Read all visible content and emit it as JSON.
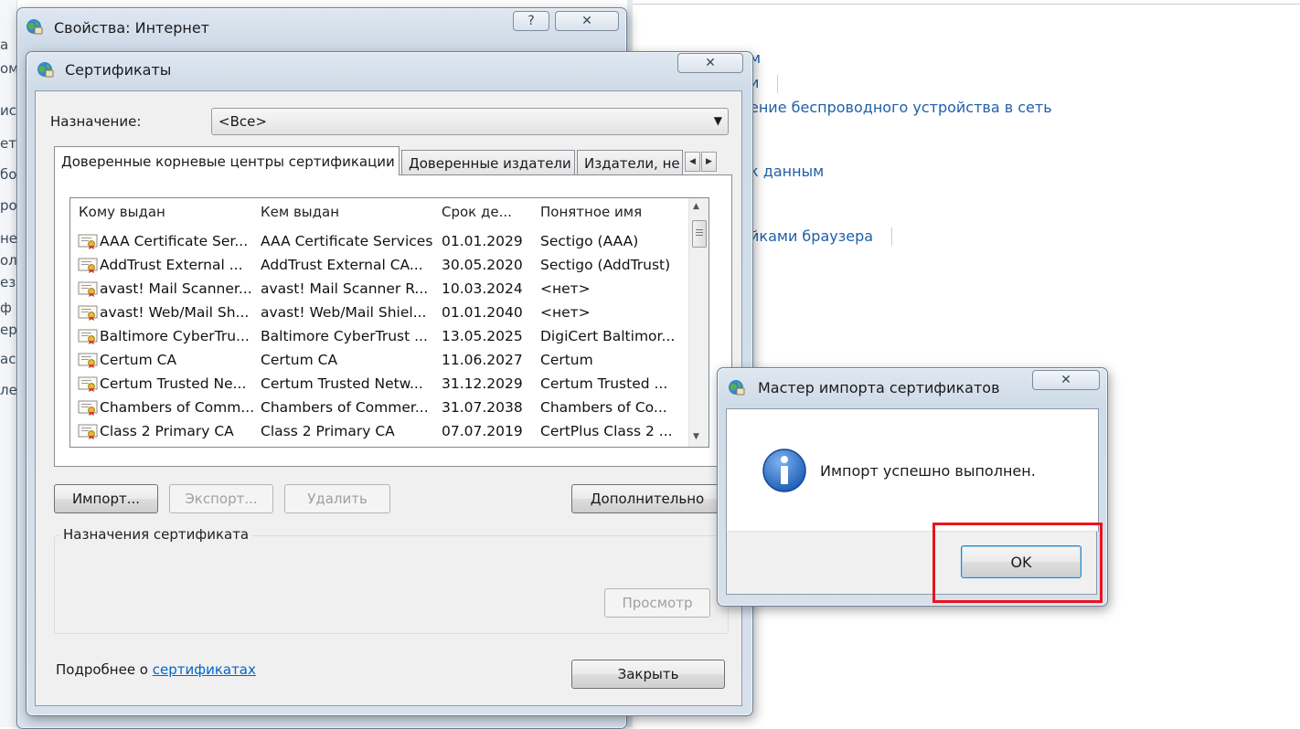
{
  "background": {
    "left_fragments": [
      "а",
      "ом",
      "ис",
      "ети",
      "бо",
      "ро",
      "не",
      "ол",
      "ез",
      "ф",
      "ер",
      "ас",
      "ле"
    ],
    "links": [
      "м",
      "и",
      "ение беспроводного устройства в сеть",
      "к данным",
      "йками браузера"
    ]
  },
  "internet_options": {
    "title": "Свойства: Интернет",
    "help_btn": "?",
    "close_btn": "✕"
  },
  "certificates": {
    "title": "Сертификаты",
    "close_btn": "✕",
    "purpose_label": "Назначение:",
    "purpose_value": "<Все>",
    "tabs": [
      {
        "label": "Доверенные корневые центры сертификации",
        "active": true
      },
      {
        "label": "Доверенные издатели",
        "active": false
      },
      {
        "label": "Издатели, не",
        "active": false
      }
    ],
    "columns": [
      "Кому выдан",
      "Кем выдан",
      "Срок де...",
      "Понятное имя"
    ],
    "rows": [
      {
        "to": "AAA Certificate Ser...",
        "by": "AAA Certificate Services",
        "exp": "01.01.2029",
        "name": "Sectigo (AAA)"
      },
      {
        "to": "AddTrust External ...",
        "by": "AddTrust External CA...",
        "exp": "30.05.2020",
        "name": "Sectigo (AddTrust)"
      },
      {
        "to": "avast! Mail Scanner...",
        "by": "avast! Mail Scanner R...",
        "exp": "10.03.2024",
        "name": "<нет>"
      },
      {
        "to": "avast! Web/Mail Sh...",
        "by": "avast! Web/Mail Shiel...",
        "exp": "01.01.2040",
        "name": "<нет>"
      },
      {
        "to": "Baltimore CyberTru...",
        "by": "Baltimore CyberTrust ...",
        "exp": "13.05.2025",
        "name": "DigiCert Baltimor..."
      },
      {
        "to": "Certum CA",
        "by": "Certum CA",
        "exp": "11.06.2027",
        "name": "Certum"
      },
      {
        "to": "Certum Trusted Ne...",
        "by": "Certum Trusted Netw...",
        "exp": "31.12.2029",
        "name": "Certum Trusted ..."
      },
      {
        "to": "Chambers of Comm...",
        "by": "Chambers of Commer...",
        "exp": "31.07.2038",
        "name": "Chambers of Co..."
      },
      {
        "to": "Class 2 Primary CA",
        "by": "Class 2 Primary CA",
        "exp": "07.07.2019",
        "name": "CertPlus Class 2 ..."
      }
    ],
    "buttons": {
      "import": "Импорт...",
      "export": "Экспорт...",
      "remove": "Удалить",
      "advanced": "Дополнительно",
      "view": "Просмотр",
      "close": "Закрыть"
    },
    "purposes_group": "Назначения сертификата",
    "more_info_prefix": "Подробнее о ",
    "more_info_link": "сертификатах"
  },
  "import_wizard": {
    "title": "Мастер импорта сертификатов",
    "close_btn": "✕",
    "message": "Импорт успешно выполнен.",
    "ok": "OK"
  },
  "colors": {
    "highlight": "#e8141e",
    "link": "#0066cc",
    "info_icon": "#1f5fb8"
  }
}
